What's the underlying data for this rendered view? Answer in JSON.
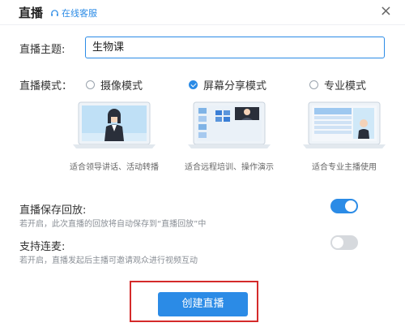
{
  "dialog": {
    "title": "直播",
    "support_link": "在线客服",
    "close": "×"
  },
  "topic": {
    "label": "直播主题:",
    "value": "生物课"
  },
  "mode": {
    "label": "直播模式：",
    "options": [
      {
        "label": "摄像模式",
        "caption": "适合领导讲话、活动转播",
        "selected": false
      },
      {
        "label": "屏幕分享模式",
        "caption": "适合远程培训、操作演示",
        "selected": true
      },
      {
        "label": "专业模式",
        "caption": "适合专业主播使用",
        "selected": false
      }
    ]
  },
  "save_replay": {
    "title": "直播保存回放:",
    "desc": "若开启，此次直播的回放将自动保存到“直播回放”中",
    "enabled": true
  },
  "co_host": {
    "title": "支持连麦:",
    "desc": "若开启，直播发起后主播可邀请观众进行视频互动",
    "enabled": false
  },
  "create_button": "创建直播",
  "colors": {
    "accent": "#2b8be6",
    "highlight_box": "#d42a2a"
  }
}
